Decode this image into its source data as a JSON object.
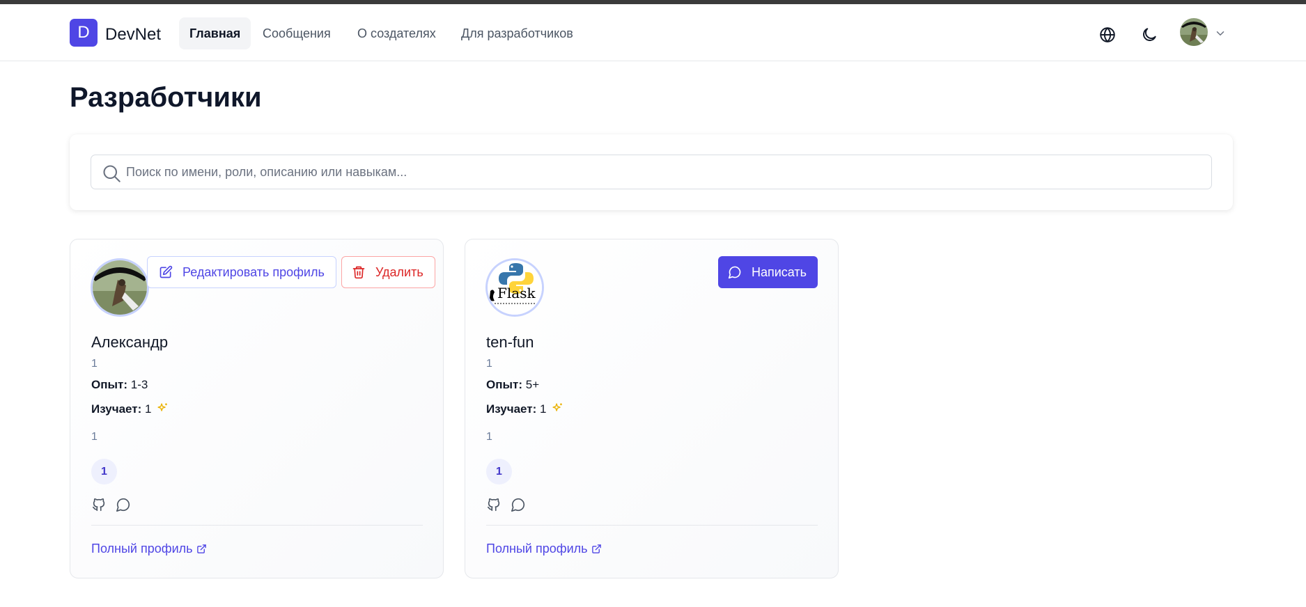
{
  "app": {
    "logo_letter": "D",
    "name": "DevNet",
    "accent": "#4f46e5"
  },
  "nav": {
    "items": [
      {
        "label": "Главная",
        "active": true
      },
      {
        "label": "Сообщения",
        "active": false
      },
      {
        "label": "О создателях",
        "active": false
      },
      {
        "label": "Для разработчиков",
        "active": false
      }
    ],
    "icons": [
      "globe-icon",
      "moon-icon",
      "user-avatar",
      "chevron-down-icon"
    ]
  },
  "page": {
    "title": "Разработчики"
  },
  "search": {
    "placeholder": "Поиск по имени, роли, описанию или навыкам...",
    "value": ""
  },
  "cards": [
    {
      "name": "Александр",
      "role": "1",
      "experience_label": "Опыт:",
      "experience_value": "1-3",
      "learning_label": "Изучает:",
      "learning_value": "1",
      "description": "1",
      "skills": [
        "1"
      ],
      "actions": {
        "edit": "Редактировать профиль",
        "delete": "Удалить"
      },
      "link": "Полный профиль"
    },
    {
      "name": "ten-fun",
      "role": "1",
      "experience_label": "Опыт:",
      "experience_value": "5+",
      "learning_label": "Изучает:",
      "learning_value": "1",
      "description": "1",
      "skills": [
        "1"
      ],
      "actions": {
        "message": "Написать"
      },
      "avatar_text": "Flask",
      "link": "Полный профиль"
    }
  ]
}
